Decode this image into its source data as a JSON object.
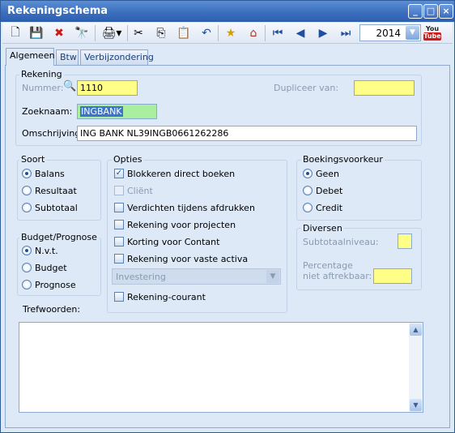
{
  "window": {
    "title": "Rekeningschema"
  },
  "toolbar": {
    "year": "2014",
    "youtube_top": "You",
    "youtube_bottom": "Tube"
  },
  "tabs": [
    "Algemeen",
    "Btw",
    "Verbijzondering"
  ],
  "rekening": {
    "group_label": "Rekening",
    "nummer_label": "Nummer:",
    "nummer_value": "1110",
    "dupliceer_label": "Dupliceer van:",
    "dupliceer_value": "",
    "zoeknaam_label": "Zoeknaam:",
    "zoeknaam_value": "INGBANK",
    "omschrijving_label": "Omschrijving:",
    "omschrijving_value": "ING BANK NL39INGB0661262286"
  },
  "soort": {
    "label": "Soort",
    "options": [
      "Balans",
      "Resultaat",
      "Subtotaal"
    ],
    "selected": "Balans"
  },
  "budget": {
    "label": "Budget/Prognose",
    "options": [
      "N.v.t.",
      "Budget",
      "Prognose"
    ],
    "selected": "N.v.t."
  },
  "opties": {
    "label": "Opties",
    "blokkeren": "Blokkeren direct boeken",
    "client": "Cliënt",
    "verdichten": "Verdichten tijdens afdrukken",
    "projecten": "Rekening voor projecten",
    "korting": "Korting voor Contant",
    "vaste_activa": "Rekening voor vaste activa",
    "investering": "Investering",
    "rekening_courant": "Rekening-courant"
  },
  "boekingsvoorkeur": {
    "label": "Boekingsvoorkeur",
    "options": [
      "Geen",
      "Debet",
      "Credit"
    ],
    "selected": "Geen"
  },
  "diversen": {
    "label": "Diversen",
    "subtotaal_label": "Subtotaalniveau:",
    "subtotaal_value": "",
    "percentage_label1": "Percentage",
    "percentage_label2": "niet aftrekbaar:",
    "percentage_value": ""
  },
  "trefwoorden": {
    "label": "Trefwoorden:",
    "value": ""
  },
  "colors": {
    "title": "#3b6fbe",
    "panel": "#dde9f7",
    "highlight_yellow": "#ffff88",
    "highlight_green": "#a8f0a0"
  }
}
